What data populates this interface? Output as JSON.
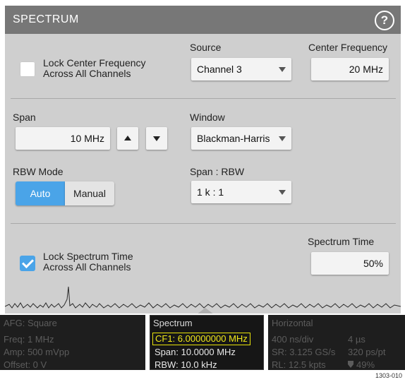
{
  "dialog": {
    "title": "SPECTRUM",
    "help_symbol": "?",
    "lock_cf": {
      "line1": "Lock Center Frequency",
      "line2": "Across All Channels",
      "checked": false
    },
    "source": {
      "label": "Source",
      "value": "Channel 3"
    },
    "center_frequency": {
      "label": "Center Frequency",
      "value": "20 MHz"
    },
    "span": {
      "label": "Span",
      "value": "10 MHz"
    },
    "window": {
      "label": "Window",
      "value": "Blackman-Harris"
    },
    "rbw_mode": {
      "label": "RBW Mode",
      "options": [
        "Auto",
        "Manual"
      ],
      "selected": "Auto"
    },
    "span_rbw": {
      "label": "Span : RBW",
      "value": "1 k : 1"
    },
    "spectrum_time": {
      "label": "Spectrum Time",
      "value": "50%"
    },
    "lock_st": {
      "line1": "Lock Spectrum Time",
      "line2": "Across All Channels",
      "checked": true
    }
  },
  "status": {
    "afg": {
      "title": "AFG: Square",
      "freq": "Freq: 1 MHz",
      "amp": "Amp: 500 mVpp",
      "offset": "Offset: 0 V"
    },
    "spectrum": {
      "title": "Spectrum",
      "cf1": "CF1: 6.00000000 MHz",
      "span": "Span: 10.0000 MHz",
      "rbw": "RBW: 10.0 kHz"
    },
    "horizontal": {
      "title": "Horizontal",
      "scale": "400 ns/div",
      "duration": "4 µs",
      "sr": "SR: 3.125 GS/s",
      "pt": "320 ps/pt",
      "rl": "RL: 12.5 kpts",
      "pos_icon": "trigger-position-icon",
      "pos": "49%"
    }
  },
  "figure_code": "1303-010",
  "colors": {
    "accent": "#4aa4e8",
    "header": "#777777",
    "panel": "#cfcfcf",
    "highlight": "#f0e81a"
  }
}
